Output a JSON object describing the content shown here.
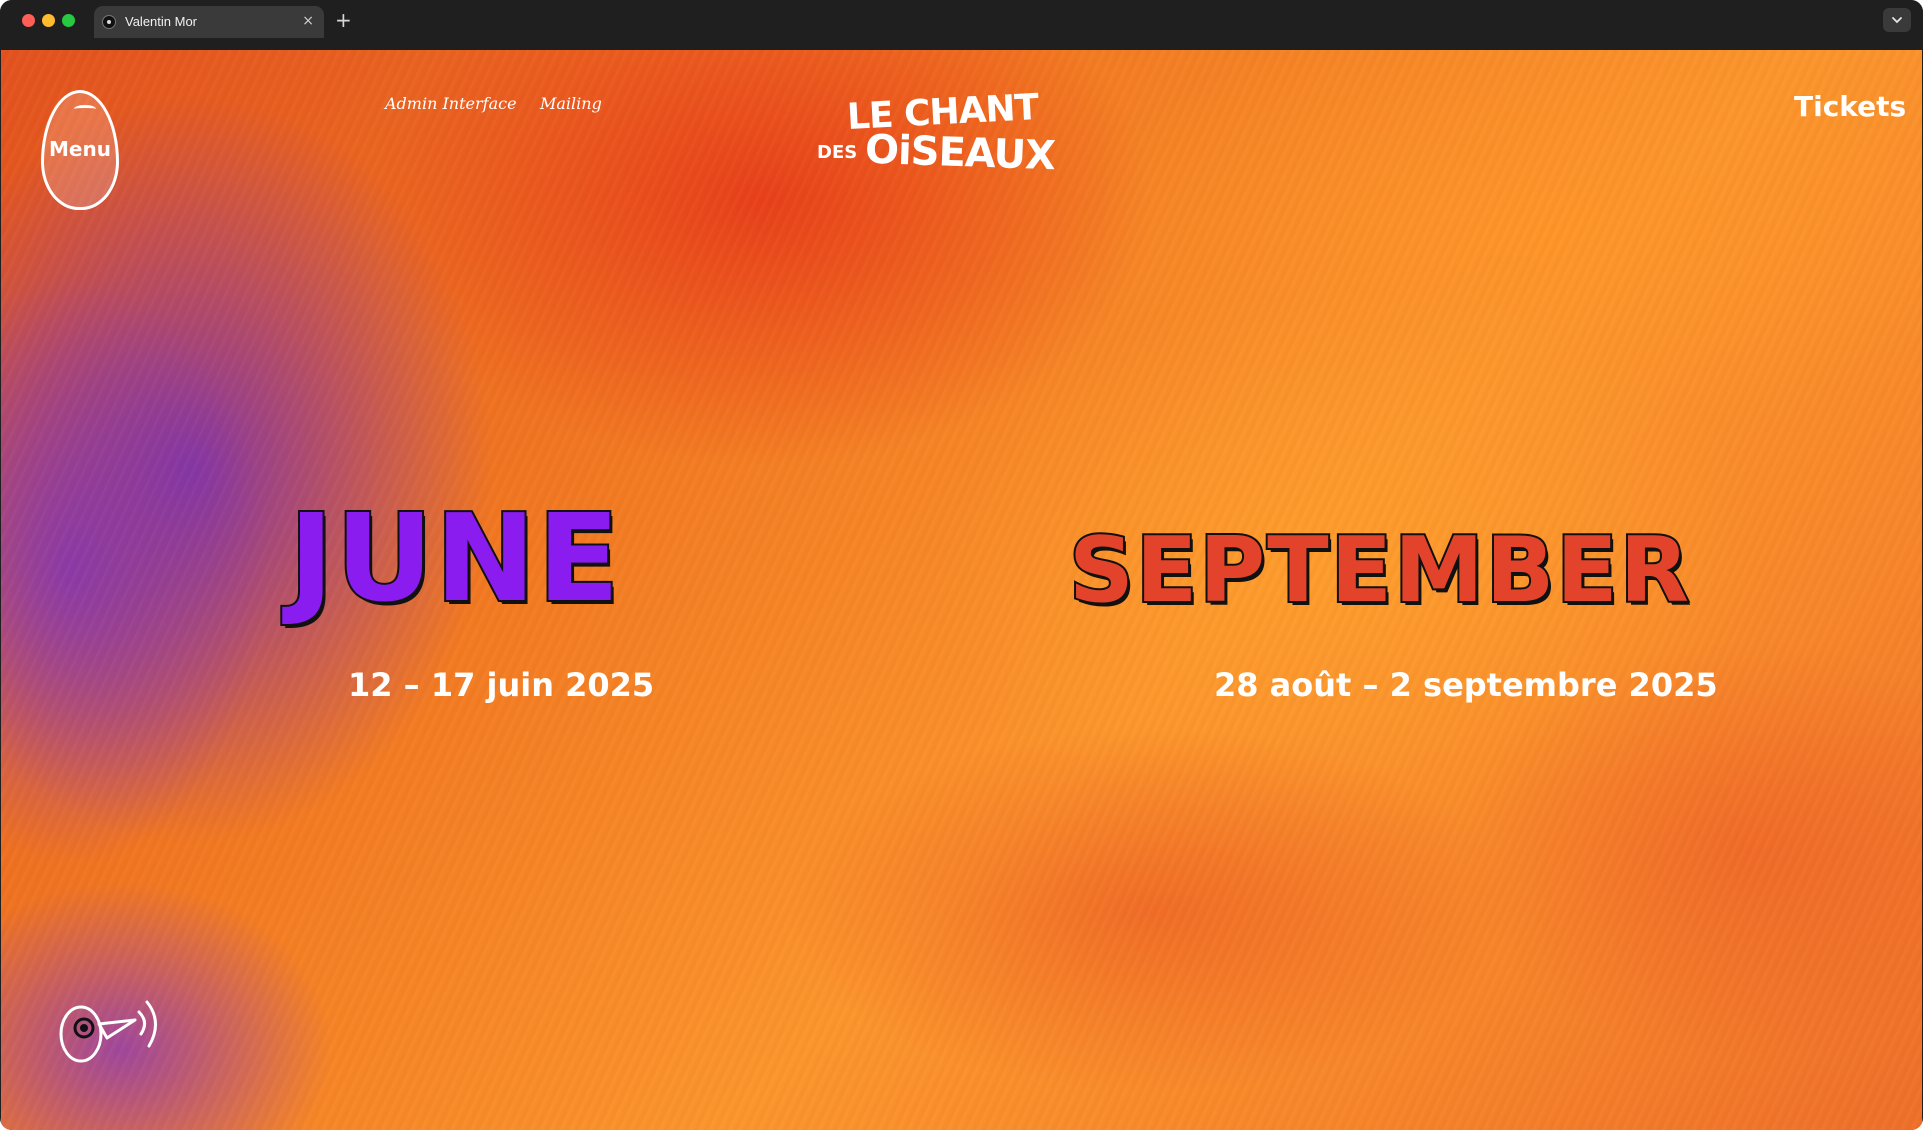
{
  "browser": {
    "tab_title": "Valentin Mor",
    "close_glyph": "×",
    "new_tab_glyph": "+",
    "icons": [
      "close-icon",
      "plus-icon",
      "chevron-down-icon"
    ]
  },
  "header": {
    "menu_label": "Menu",
    "nav": [
      {
        "label": "Admin Interface"
      },
      {
        "label": "Mailing"
      }
    ],
    "logo": {
      "line1": "LE CHANT",
      "line2": "DES",
      "line3": "OiSEAUX"
    },
    "tickets_label": "Tickets"
  },
  "hero": {
    "seasons": [
      {
        "title": "JUNE",
        "dates": "12 – 17 juin 2025",
        "color": "#8a1cf0"
      },
      {
        "title": "SEPTEMBER",
        "dates": "28 août – 2 septembre 2025",
        "color": "#e2432a"
      }
    ]
  },
  "sound_toggle": {
    "icon": "sound-bird-icon"
  },
  "colors": {
    "background_accent": "#f27a22",
    "text": "#ffffff"
  }
}
